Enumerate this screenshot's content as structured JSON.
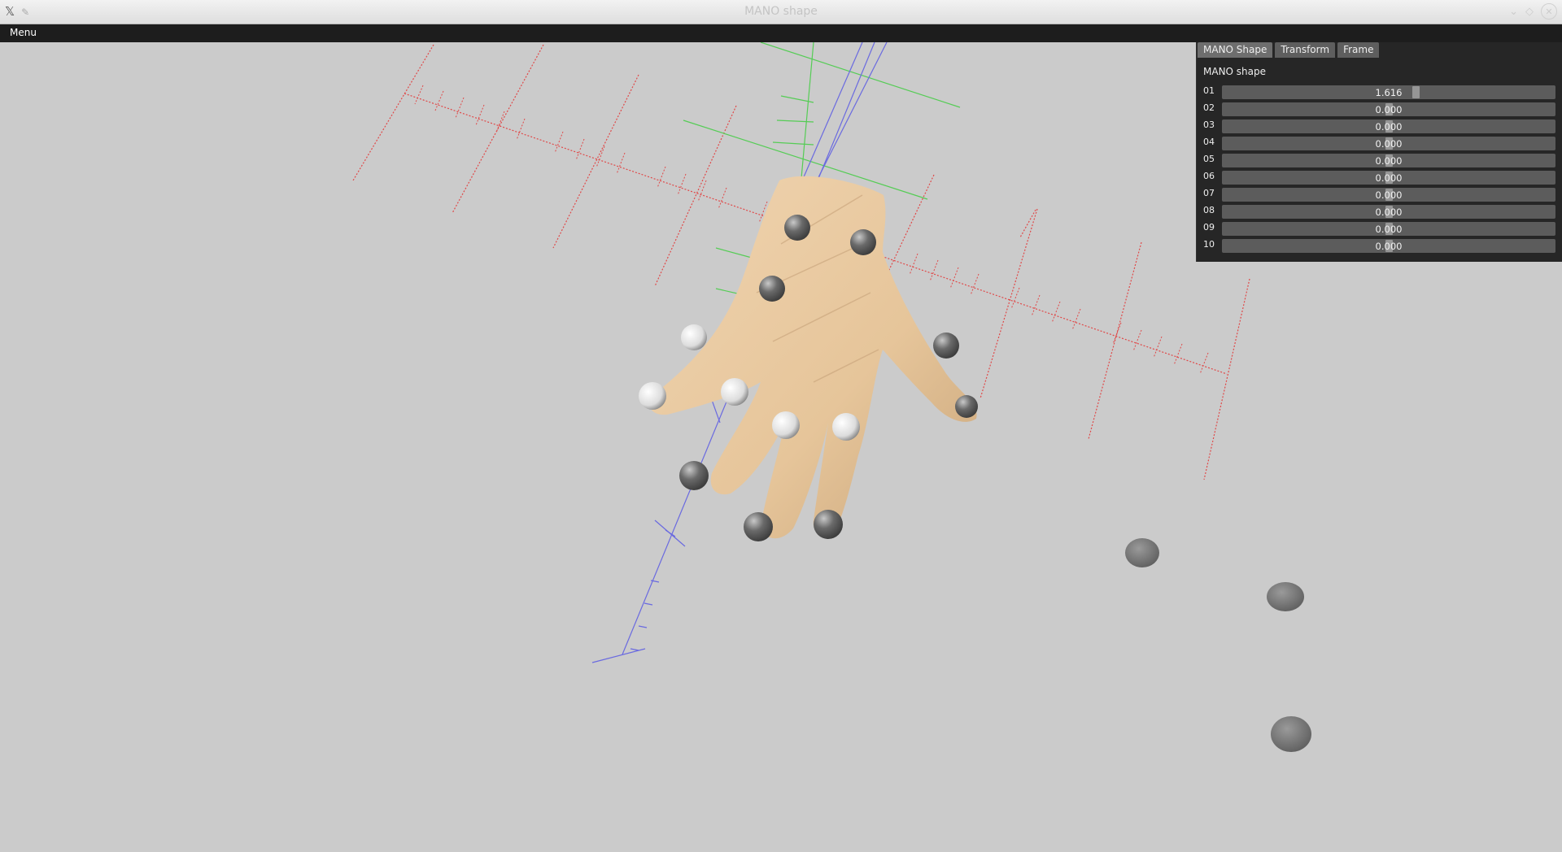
{
  "window": {
    "title": "MANO shape",
    "app_icon": "x-logo-icon",
    "pin_icon": "pin-icon",
    "controls": [
      "minimize-icon",
      "maximize-icon",
      "close-icon"
    ]
  },
  "menubar": {
    "menu_label": "Menu"
  },
  "panel": {
    "tabs": [
      {
        "label": "MANO Shape",
        "active": true
      },
      {
        "label": "Transform",
        "active": false
      },
      {
        "label": "Frame",
        "active": false
      }
    ],
    "section_title": "MANO shape",
    "params": [
      {
        "label": "01",
        "value": "1.616",
        "fraction": 0.58
      },
      {
        "label": "02",
        "value": "0.000",
        "fraction": 0.5
      },
      {
        "label": "03",
        "value": "0.000",
        "fraction": 0.5
      },
      {
        "label": "04",
        "value": "0.000",
        "fraction": 0.5
      },
      {
        "label": "05",
        "value": "0.000",
        "fraction": 0.5
      },
      {
        "label": "06",
        "value": "0.000",
        "fraction": 0.5
      },
      {
        "label": "07",
        "value": "0.000",
        "fraction": 0.5
      },
      {
        "label": "08",
        "value": "0.000",
        "fraction": 0.5
      },
      {
        "label": "09",
        "value": "0.000",
        "fraction": 0.5
      },
      {
        "label": "10",
        "value": "0.000",
        "fraction": 0.5
      }
    ]
  },
  "viewport": {
    "background": "#cbcbcb",
    "axis_colors": {
      "x": "#e04848",
      "y": "#55cc55",
      "z": "#6a6ae0"
    },
    "skin_color": "#e8c9a0",
    "joint_marker_colors": [
      "#ededed",
      "#6a6a6a"
    ]
  }
}
